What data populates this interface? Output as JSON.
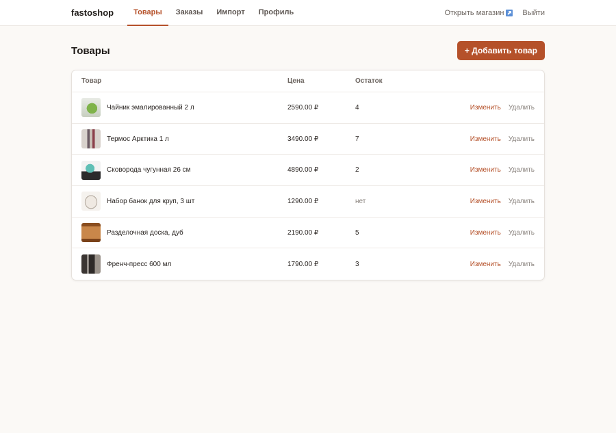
{
  "header": {
    "brand": "fastoshop",
    "nav": [
      {
        "label": "Товары",
        "active": true
      },
      {
        "label": "Заказы",
        "active": false
      },
      {
        "label": "Импорт",
        "active": false
      },
      {
        "label": "Профиль",
        "active": false
      }
    ],
    "open_store_label": "Открыть магазин",
    "open_store_icon": "external-link-icon",
    "logout_label": "Выйти"
  },
  "page": {
    "title": "Товары",
    "add_button_label": "+ Добавить товар"
  },
  "table": {
    "columns": {
      "product": "Товар",
      "price": "Цена",
      "stock": "Остаток"
    },
    "edit_label": "Изменить",
    "delete_label": "Удалить",
    "rows": [
      {
        "name": "Чайник эмалированный 2 л",
        "price": "2590.00 ₽",
        "stock": "4",
        "thumb": "kettle"
      },
      {
        "name": "Термос Арктика 1 л",
        "price": "3490.00 ₽",
        "stock": "7",
        "thumb": "thermos"
      },
      {
        "name": "Сковорода чугунная 26 см",
        "price": "4890.00 ₽",
        "stock": "2",
        "thumb": "pan"
      },
      {
        "name": "Набор банок для круп, 3 шт",
        "price": "1290.00 ₽",
        "stock": "нет",
        "thumb": "jars"
      },
      {
        "name": "Разделочная доска, дуб",
        "price": "2190.00 ₽",
        "stock": "5",
        "thumb": "board"
      },
      {
        "name": "Френч-пресс 600 мл",
        "price": "1790.00 ₽",
        "stock": "3",
        "thumb": "press"
      }
    ]
  },
  "colors": {
    "accent": "#b5512a",
    "background": "#fbf9f6",
    "card": "#ffffff"
  }
}
